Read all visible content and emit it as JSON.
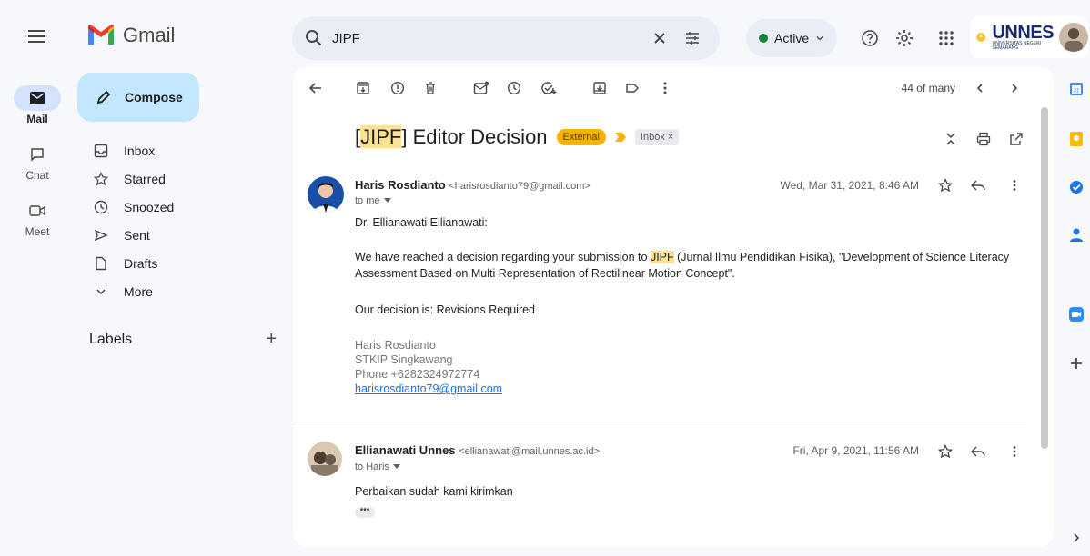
{
  "app": {
    "logo_text": "Gmail"
  },
  "rail": {
    "items": [
      {
        "label": "Mail",
        "icon": "mail-icon",
        "active": true
      },
      {
        "label": "Chat",
        "icon": "chat-icon"
      },
      {
        "label": "Meet",
        "icon": "video-icon"
      }
    ]
  },
  "compose": {
    "label": "Compose"
  },
  "nav": {
    "items": [
      {
        "label": "Inbox",
        "icon": "inbox-icon"
      },
      {
        "label": "Starred",
        "icon": "star-icon"
      },
      {
        "label": "Snoozed",
        "icon": "clock-icon"
      },
      {
        "label": "Sent",
        "icon": "send-icon"
      },
      {
        "label": "Drafts",
        "icon": "file-icon"
      },
      {
        "label": "More",
        "icon": "chevron-down-icon"
      }
    ],
    "labels_heading": "Labels",
    "labels_add": "+"
  },
  "search": {
    "value": "JIPF"
  },
  "status": {
    "label": "Active",
    "color": "#188038"
  },
  "account": {
    "org_logo_text": "UNNES",
    "org_logo_sub": "UNIVERSITAS NEGERI SEMARANG"
  },
  "toolbar": {
    "pager": "44 of many"
  },
  "thread": {
    "subject_highlight": "JIPF",
    "subject_pre": "[",
    "subject_post": "] Editor Decision",
    "badge_external": "External",
    "badge_inbox": "Inbox",
    "badge_inbox_close": "×"
  },
  "messages": [
    {
      "sender_name": "Haris Rosdianto",
      "sender_email": "<harisrosdianto79@gmail.com>",
      "to": "to me",
      "date": "Wed, Mar 31, 2021, 8:46 AM",
      "greeting": "Dr. Ellianawati Ellianawati:",
      "para1_pre": "We have reached a decision regarding your submission to ",
      "para1_highlight": "JIPF",
      "para1_post": " (Jurnal Ilmu Pendidikan Fisika), \"Development of Science Literacy Assessment Based on Multi Representation of Rectilinear Motion Concept\".",
      "decision": "Our decision is: Revisions Required",
      "sig_name": "Haris Rosdianto",
      "sig_org": "STKIP Singkawang",
      "sig_phone": "Phone +6282324972774",
      "sig_email": "harisrosdianto79@gmail.com"
    },
    {
      "sender_name": "Ellianawati Unnes",
      "sender_email": "<ellianawati@mail.unnes.ac.id>",
      "to": "to Haris",
      "date": "Fri, Apr 9, 2021, 11:56 AM",
      "body": "Perbaikan sudah kami kirimkan",
      "dots": "•••"
    }
  ],
  "colors": {
    "accent": "#c2e7ff",
    "external_badge": "#f5b400",
    "highlight": "#fde293",
    "link": "#1a73e8"
  }
}
